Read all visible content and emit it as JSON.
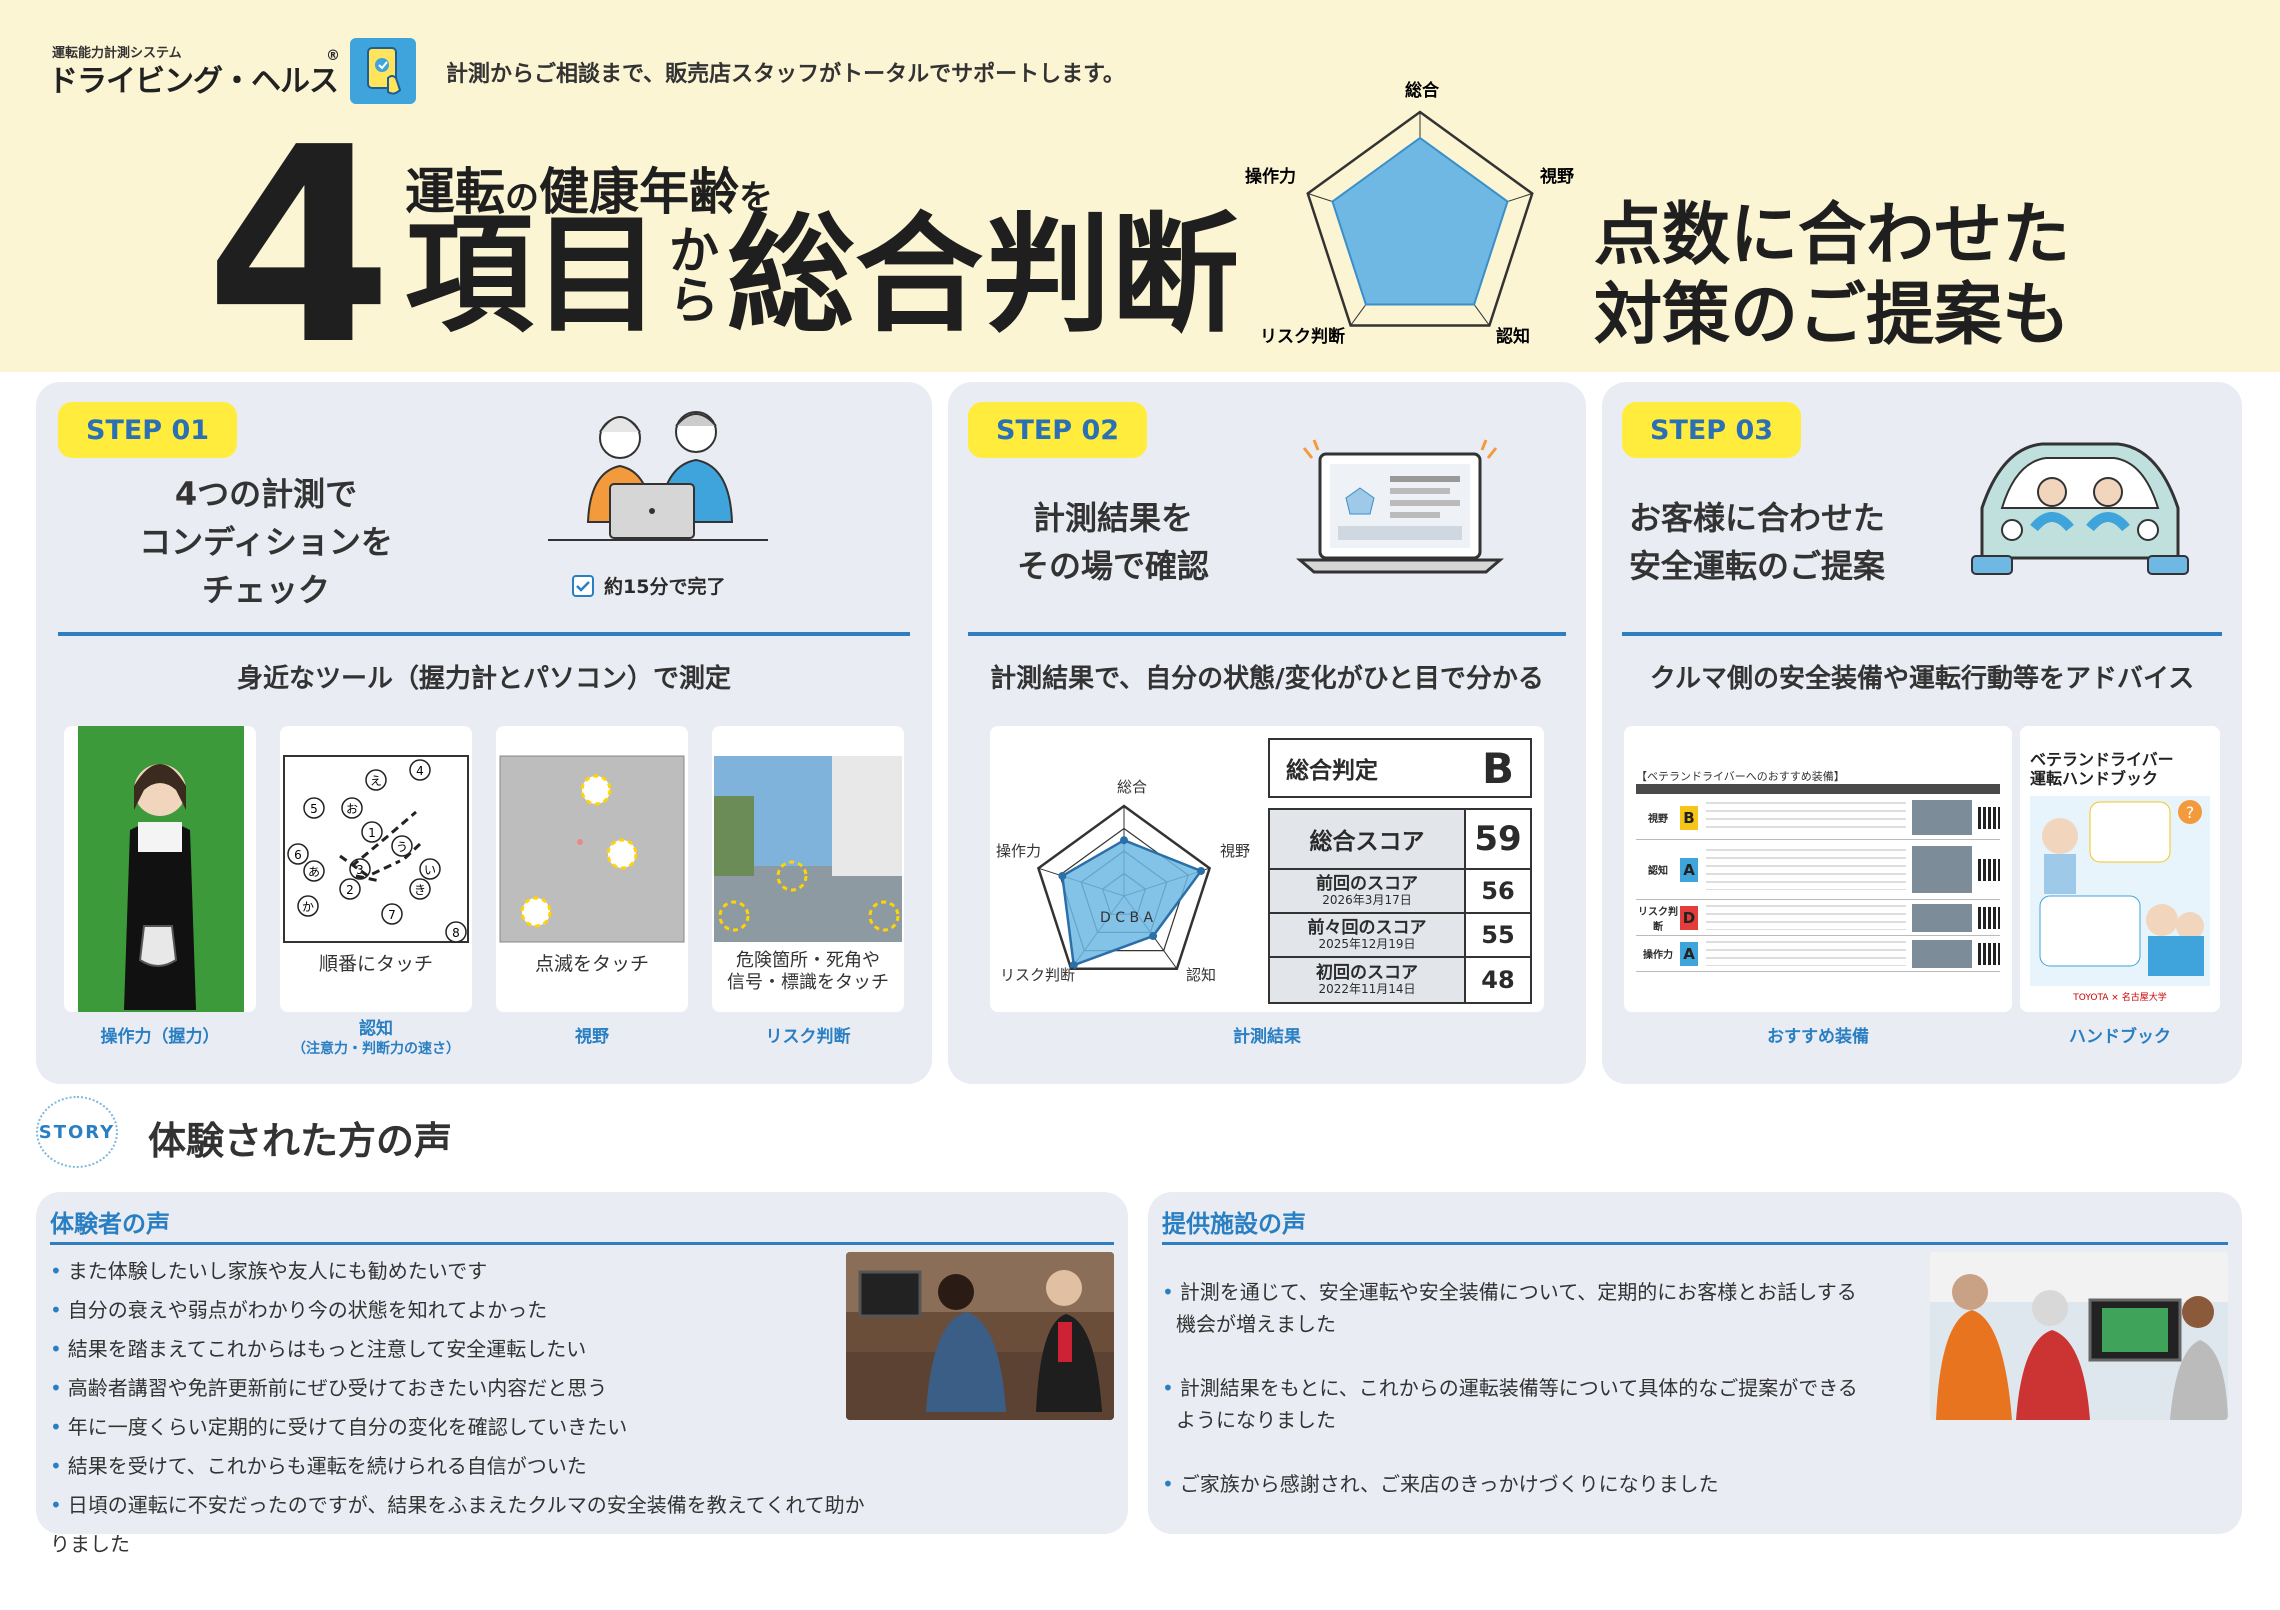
{
  "header": {
    "logo_small": "運転能力計測システム",
    "logo_main": "ドライビング・ヘルス",
    "logo_reg": "®",
    "tagline": "計測からご相談まで、販売店スタッフがトータルでサポートします。",
    "big_number": "4",
    "headline_top_a": "運転",
    "headline_top_b": "の",
    "headline_top_c": "健康年齢",
    "headline_top_d": "を",
    "headline_main_a": "項目",
    "headline_kara_1": "か",
    "headline_kara_2": "ら",
    "headline_main_b": "総合判断",
    "right_line1": "点数に合わせた",
    "right_line2": "対策のご提案も",
    "radar_labels": [
      "総合",
      "視野",
      "認知",
      "リスク判断",
      "操作力"
    ]
  },
  "step1": {
    "badge": "STEP 01",
    "title_lines": [
      "4つの計測で",
      "コンディションを",
      "チェック"
    ],
    "check_note": "約15分で完了",
    "subhead": "身近なツール（握力計とパソコン）で測定",
    "card2_text": "順番にタッチ",
    "card3_text": "点滅をタッチ",
    "card4_text_1": "危険箇所・死角や",
    "card4_text_2": "信号・標識をタッチ",
    "captions": [
      "操作力（握力）",
      "認知",
      "（注意力・判断力の速さ）",
      "視野",
      "リスク判断"
    ],
    "touch_circles": [
      "え",
      "④",
      "⑤",
      "お",
      "①",
      "⑥",
      "う",
      "あ",
      "③",
      "い",
      "②",
      "き",
      "か",
      "⑦",
      "⑧"
    ]
  },
  "step2": {
    "badge": "STEP 02",
    "title_lines": [
      "計測結果を",
      "その場で確認"
    ],
    "subhead": "計測結果で、自分の状態/変化がひと目で分かる",
    "radar_labels": [
      "総合",
      "視野",
      "認知",
      "リスク判断",
      "操作力"
    ],
    "radar_grades": "D C B A",
    "radar_values": [
      0.62,
      0.9,
      0.55,
      0.95,
      0.72
    ],
    "judgement_label": "総合判定",
    "judgement_value": "B",
    "total_label": "総合スコア",
    "total_value": "59",
    "history": [
      {
        "label": "前回のスコア",
        "date": "2026年3月17日",
        "value": "56"
      },
      {
        "label": "前々回のスコア",
        "date": "2025年12月19日",
        "value": "55"
      },
      {
        "label": "初回のスコア",
        "date": "2022年11月14日",
        "value": "48"
      }
    ],
    "caption": "計測結果"
  },
  "step3": {
    "badge": "STEP 03",
    "title_lines": [
      "お客様に合わせた",
      "安全運転のご提案"
    ],
    "subhead": "クルマ側の安全装備や運転行動等をアドバイス",
    "table_title": "【ベテランドライバーへのおすすめ装備】",
    "table_rows": [
      {
        "item": "視野",
        "grade": "B",
        "color": "#f5c518"
      },
      {
        "item": "認知",
        "grade": "A",
        "color": "#3fa3dc"
      },
      {
        "item": "リスク判断",
        "grade": "D",
        "color": "#e23c3c"
      },
      {
        "item": "操作力",
        "grade": "A",
        "color": "#3fa3dc"
      }
    ],
    "handbook_title_1": "ベテランドライバー",
    "handbook_title_2": "運転ハンドブック",
    "handbook_footer": "TOYOTA × 名古屋大学",
    "caption_left": "おすすめ装備",
    "caption_right": "ハンドブック"
  },
  "story": {
    "badge": "STORY",
    "title": "体験された方の声",
    "users_head": "体験者の声",
    "users": [
      "また体験したいし家族や友人にも勧めたいです",
      "自分の衰えや弱点がわかり今の状態を知れてよかった",
      "結果を踏まえてこれからはもっと注意して安全運転したい",
      "高齢者講習や免許更新前にぜひ受けておきたい内容だと思う",
      "年に一度くらい定期的に受けて自分の変化を確認していきたい",
      "結果を受けて、これからも運転を続けられる自信がついた",
      "日頃の運転に不安だったのですが、結果をふまえたクルマの安全装備を教えてくれて助かりました"
    ],
    "facility_head": "提供施設の声",
    "facility": [
      {
        "l1": "計測を通じて、安全運転や安全装備について、定期的にお客様とお話しする",
        "l2": "機会が増えました"
      },
      {
        "l1": "計測結果をもとに、これからの運転装備等について具体的なご提案ができる",
        "l2": "ようになりました"
      },
      {
        "l1": "ご家族から感謝され、ご来店のきっかけづくりになりました",
        "l2": ""
      }
    ]
  },
  "colors": {
    "header_bg": "#fbf5d4",
    "panel_bg": "#e9edf3",
    "accent_blue": "#2f7ec0",
    "badge_yellow": "#ffec3d",
    "radar_fill": "#6fb8e4"
  }
}
